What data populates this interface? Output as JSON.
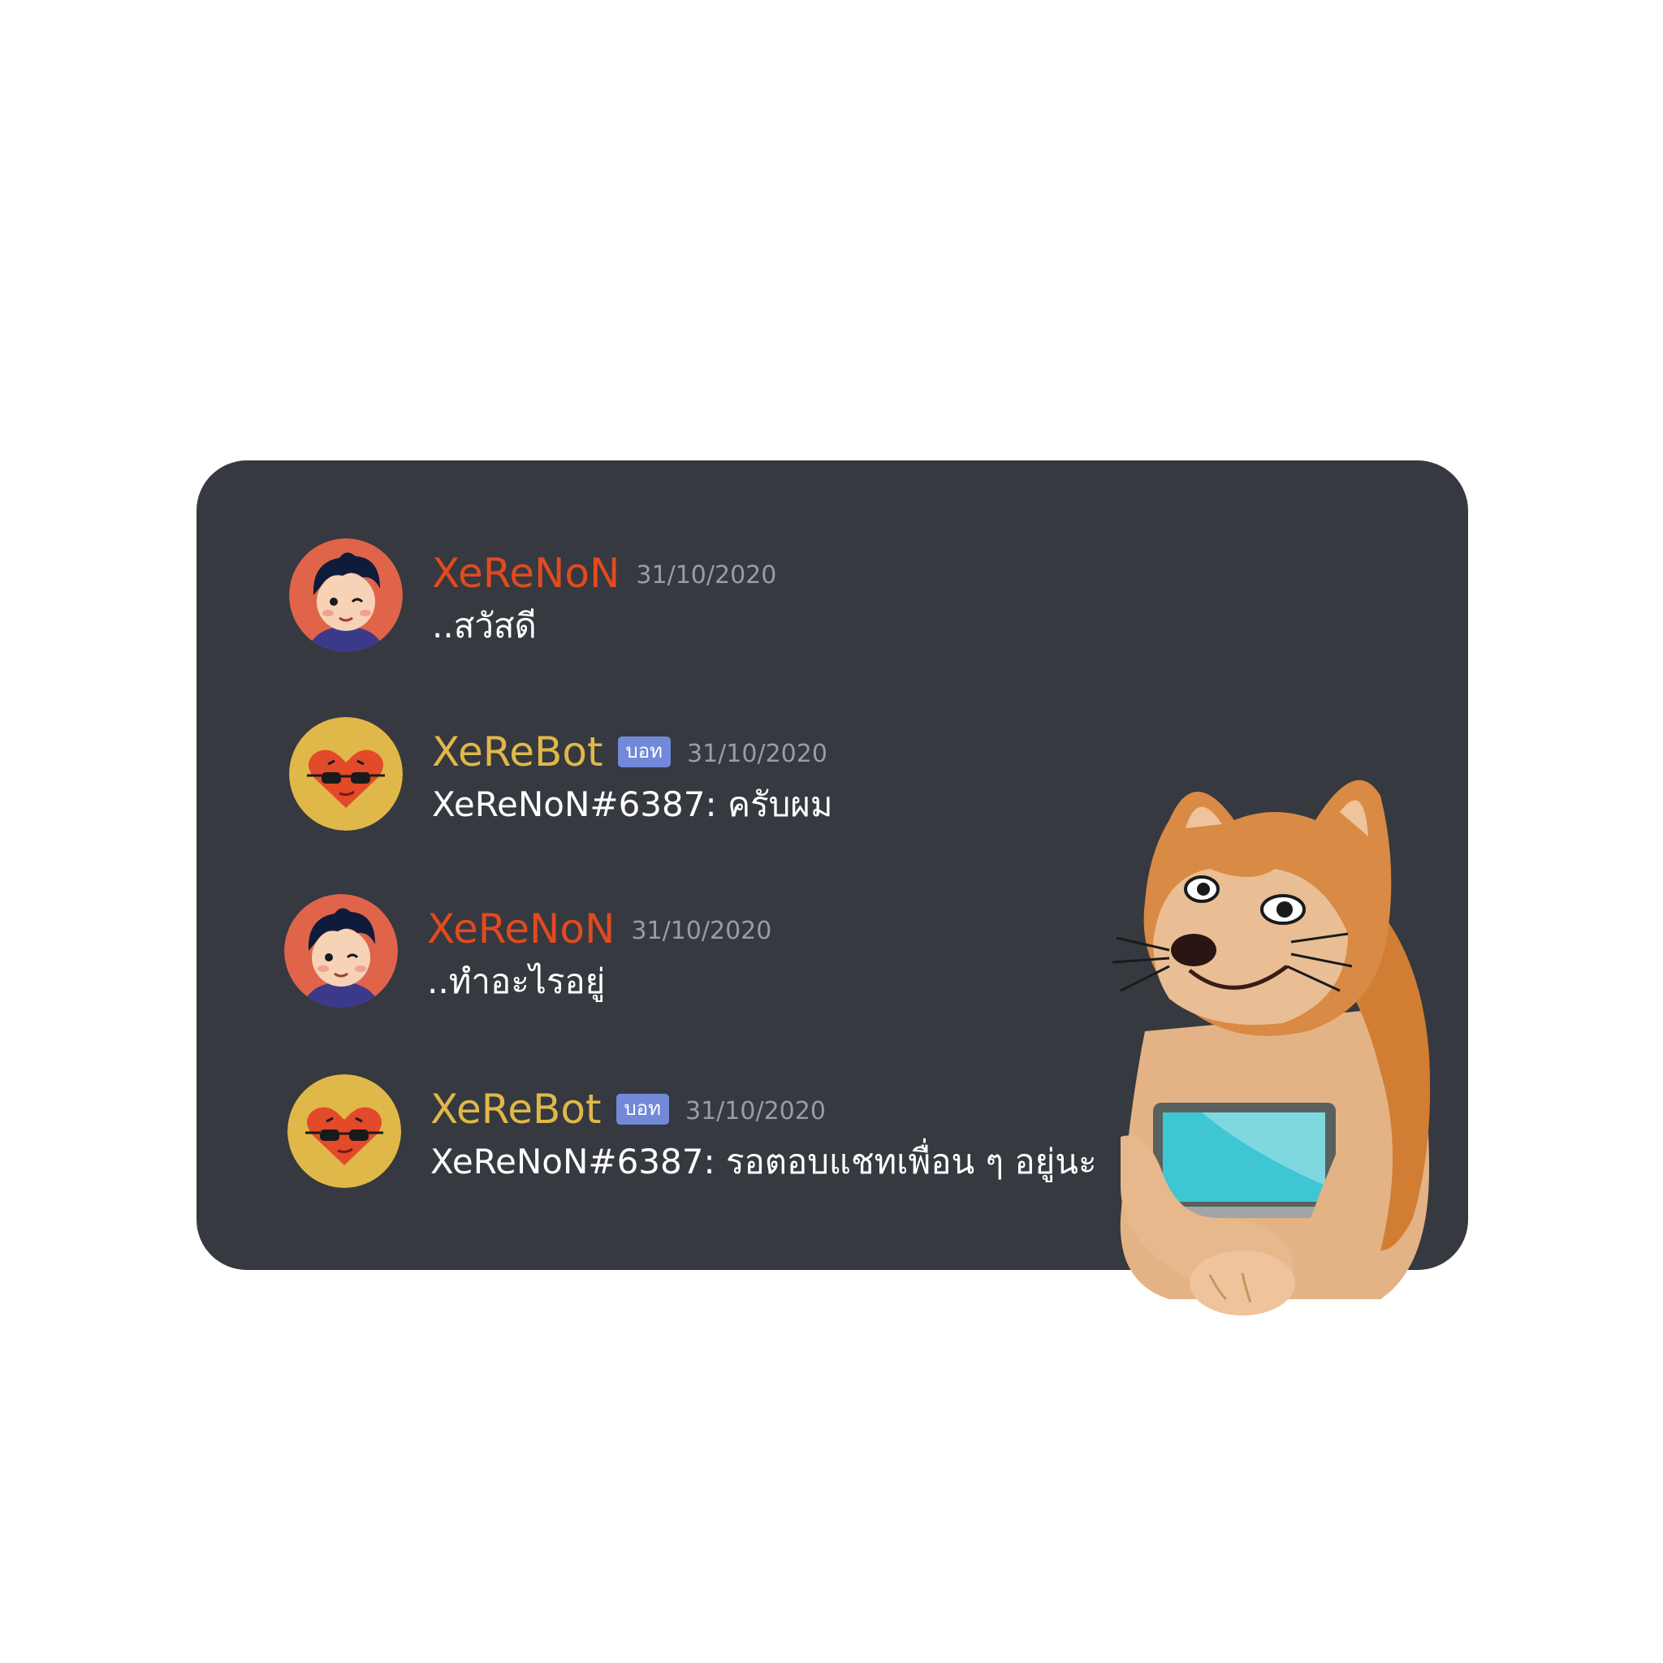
{
  "colors": {
    "page_background": "#ffffff",
    "chat_background": "#36393f",
    "user_name": "#e24a1f",
    "bot_name": "#e0b849",
    "bot_tag": "#7289da",
    "timestamp": "#9a9ca2",
    "message_text": "#ffffff"
  },
  "messages": [
    {
      "author": "XeReNoN",
      "role": "user",
      "avatar_icon": "boy-avatar-icon",
      "timestamp": "31/10/2020",
      "text": "..สวัสดี"
    },
    {
      "author": "XeReBot",
      "role": "bot",
      "avatar_icon": "heart-sunglasses-avatar-icon",
      "bot_tag": "บอท",
      "timestamp": "31/10/2020",
      "text": "XeReNoN#6387: ครับผม"
    },
    {
      "author": "XeReNoN",
      "role": "user",
      "avatar_icon": "boy-avatar-icon",
      "timestamp": "31/10/2020",
      "text": "..ทำอะไรอยู่"
    },
    {
      "author": "XeReBot",
      "role": "bot",
      "avatar_icon": "heart-sunglasses-avatar-icon",
      "bot_tag": "บอท",
      "timestamp": "31/10/2020",
      "text": "XeReNoN#6387: รอตอบแชทเพื่อน ๆ อยู่นะ"
    }
  ],
  "illustration": {
    "icon": "doge-with-laptop-icon"
  }
}
